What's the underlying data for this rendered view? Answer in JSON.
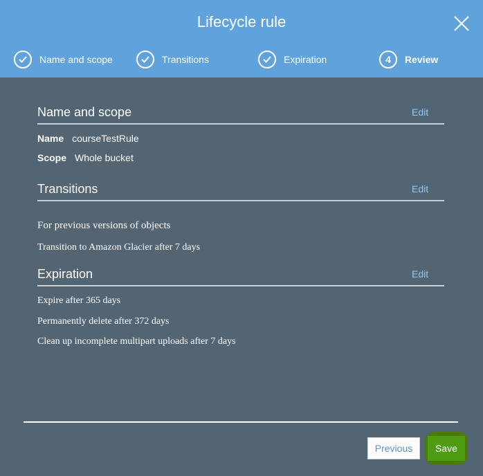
{
  "dialog": {
    "title": "Lifecycle rule"
  },
  "steps": [
    {
      "label": "Name and scope",
      "state": "complete",
      "icon": "checkmark-icon"
    },
    {
      "label": "Transitions",
      "state": "complete",
      "icon": "checkmark-icon"
    },
    {
      "label": "Expiration",
      "state": "complete",
      "icon": "checkmark-icon"
    },
    {
      "label": "Review",
      "state": "current",
      "number": "4"
    }
  ],
  "sections": {
    "name_scope": {
      "title": "Name and scope",
      "edit_label": "Edit",
      "name_key": "Name",
      "name_value": "courseTestRule",
      "scope_key": "Scope",
      "scope_value": "Whole bucket"
    },
    "transitions": {
      "title": "Transitions",
      "edit_label": "Edit",
      "line1": "For previous versions of objects",
      "line2": "Transition to  Amazon Glacier after 7 days"
    },
    "expiration": {
      "title": "Expiration",
      "edit_label": "Edit",
      "line1": "Expire after 365 days",
      "line2": "Permanently delete after 372 days",
      "line3": "Clean up incomplete multipart uploads after 7 days"
    }
  },
  "footer": {
    "previous_label": "Previous",
    "save_label": "Save"
  },
  "colors": {
    "header": "#5fa2dc",
    "body": "#536472",
    "link": "#8fc9f5",
    "save": "#4d9c12"
  }
}
